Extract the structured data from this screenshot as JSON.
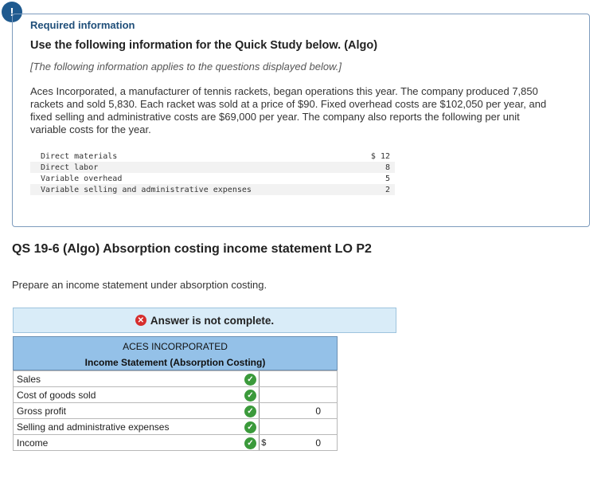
{
  "info": {
    "alert_glyph": "!",
    "required_heading": "Required information",
    "use_line": "Use the following information for the Quick Study below. (Algo)",
    "applies_line": "[The following information applies to the questions displayed below.]",
    "intro": "Aces Incorporated, a manufacturer of tennis rackets, began operations this year. The company produced 7,850 rackets and sold 5,830. Each racket was sold at a price of $90. Fixed overhead costs are $102,050 per year, and fixed selling and administrative costs are $69,000 per year. The company also reports the following per unit variable costs for the year.",
    "costs": [
      {
        "label": "Direct materials",
        "value": "$ 12"
      },
      {
        "label": "Direct labor",
        "value": "8"
      },
      {
        "label": "Variable overhead",
        "value": "5"
      },
      {
        "label": "Variable selling and administrative expenses",
        "value": "2"
      }
    ]
  },
  "question": {
    "title": "QS 19-6 (Algo) Absorption costing income statement LO P2",
    "prompt": "Prepare an income statement under absorption costing."
  },
  "status": {
    "text": "Answer is not complete.",
    "icon": "x-circle-icon",
    "color": "#d62e2e"
  },
  "statement": {
    "company": "ACES INCORPORATED",
    "title": "Income Statement (Absorption Costing)",
    "rows": [
      {
        "label": "Sales",
        "currency": "",
        "amount": ""
      },
      {
        "label": "Cost of goods sold",
        "currency": "",
        "amount": ""
      },
      {
        "label": "Gross profit",
        "currency": "",
        "amount": "0"
      },
      {
        "label": "Selling and administrative expenses",
        "currency": "",
        "amount": ""
      },
      {
        "label": "Income",
        "currency": "$",
        "amount": "0"
      }
    ],
    "check_glyph": "✓",
    "check_color": "#3b9a3b"
  }
}
